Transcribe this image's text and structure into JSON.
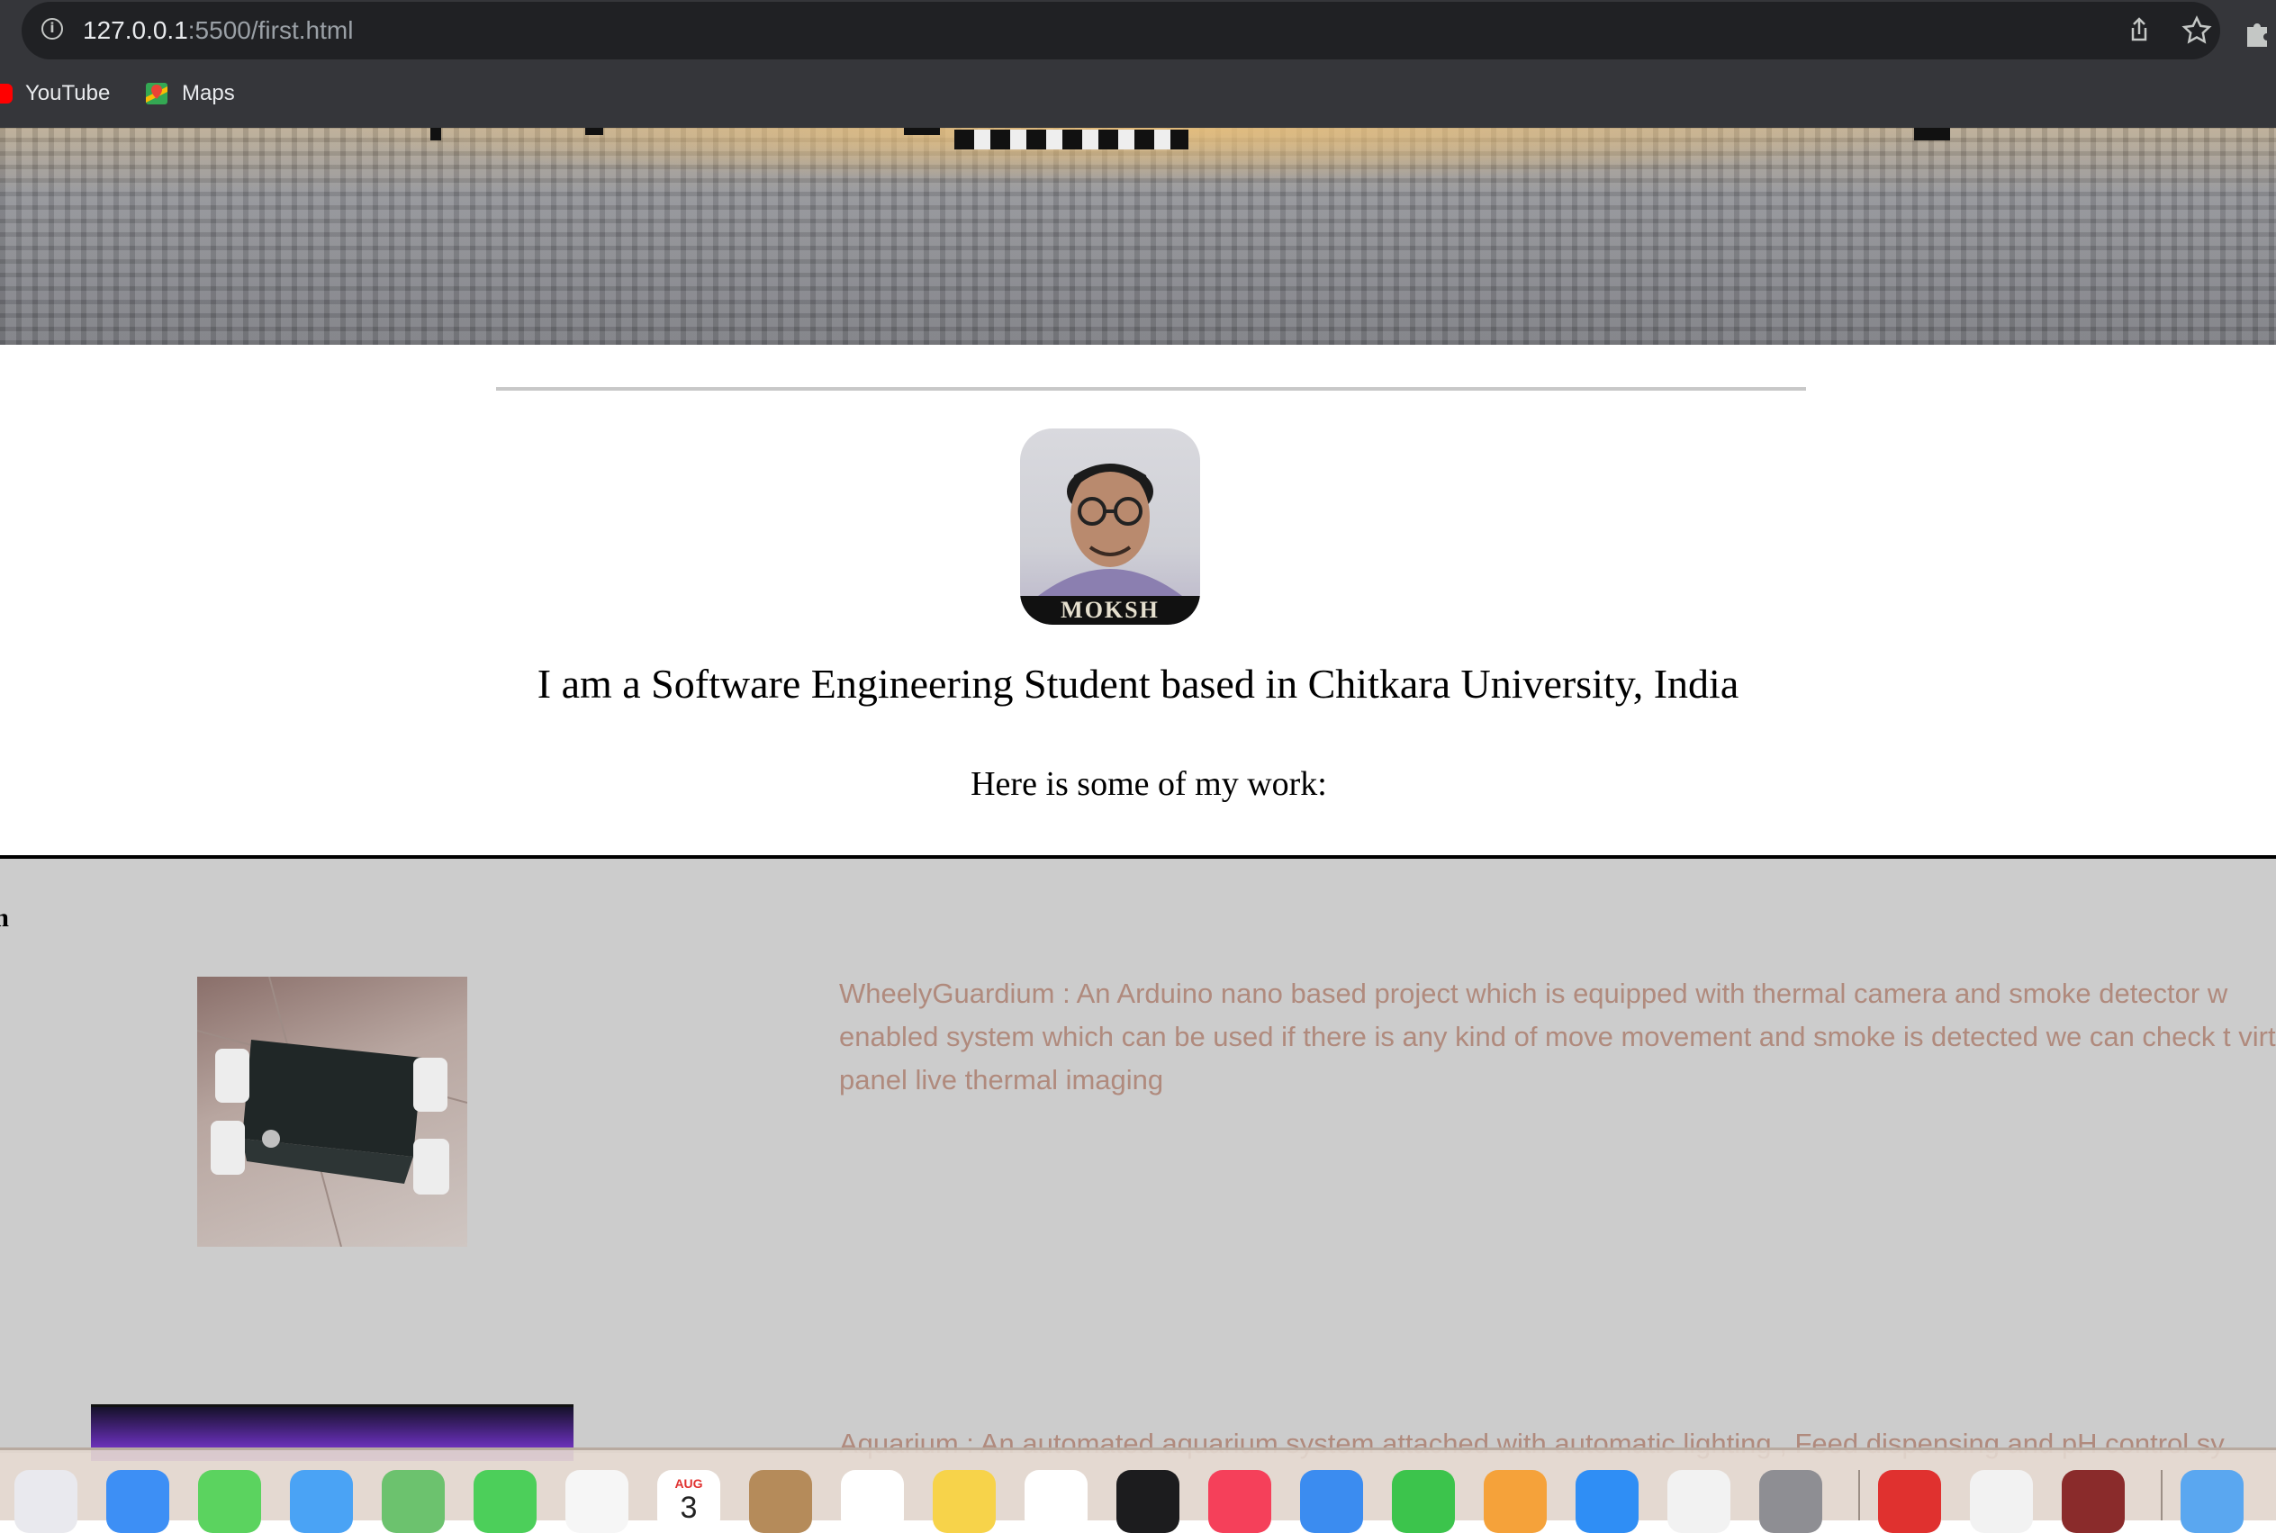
{
  "browser": {
    "url_host": "127.0.0.1",
    "url_rest": ":5500/first.html",
    "bookmarks": [
      {
        "label": "YouTube",
        "icon": "youtube-icon"
      },
      {
        "label": "Maps",
        "icon": "maps-icon"
      }
    ]
  },
  "page": {
    "avatar_caption": "MOKSH",
    "tagline": "I am a Software Engineering Student based in Chitkara University, India",
    "subtitle": "Here is some of my work:"
  },
  "projects": [
    {
      "title": "rdium",
      "description": "WheelyGuardium : An Arduino nano based project which is equipped with thermal camera and smoke detector w enabled system which can be used if there is any kind of move movement and smoke is detected we can check t virtual panel live thermal imaging"
    },
    {
      "title": "",
      "description": "Aquarium : An automated aquarium system attached with automatic lighting , Feed dispensing and pH control sy"
    }
  ],
  "dock": {
    "calendar_month": "AUG",
    "calendar_day": "3",
    "apps": [
      {
        "name": "launchpad",
        "color": "#e9e9ee"
      },
      {
        "name": "safari",
        "color": "#3d8ff5"
      },
      {
        "name": "messages",
        "color": "#5bd35f"
      },
      {
        "name": "mail",
        "color": "#4aa3f5"
      },
      {
        "name": "maps",
        "color": "#6cc26e"
      },
      {
        "name": "facetime",
        "color": "#4ccf5a"
      },
      {
        "name": "photos",
        "color": "#f6f6f6"
      },
      {
        "name": "calendar",
        "color": "#ffffff"
      },
      {
        "name": "contacts",
        "color": "#b58b5a"
      },
      {
        "name": "reminders",
        "color": "#ffffff"
      },
      {
        "name": "notes",
        "color": "#f7d34a"
      },
      {
        "name": "freeform",
        "color": "#ffffff"
      },
      {
        "name": "tv",
        "color": "#1c1c1e"
      },
      {
        "name": "music",
        "color": "#f5405a"
      },
      {
        "name": "keynote",
        "color": "#3b8cf0"
      },
      {
        "name": "numbers",
        "color": "#3cc44c"
      },
      {
        "name": "pages",
        "color": "#f5a23a"
      },
      {
        "name": "app-store",
        "color": "#2f8ef5"
      },
      {
        "name": "chrome",
        "color": "#f2f2f2"
      },
      {
        "name": "system-settings",
        "color": "#8e8e93"
      },
      {
        "name": "photo-booth",
        "color": "#e0312f"
      },
      {
        "name": "vs-code",
        "color": "#f2f2f2"
      },
      {
        "name": "dictionary",
        "color": "#8a2b2b"
      },
      {
        "name": "downloads",
        "color": "#5aa7f0"
      }
    ]
  }
}
